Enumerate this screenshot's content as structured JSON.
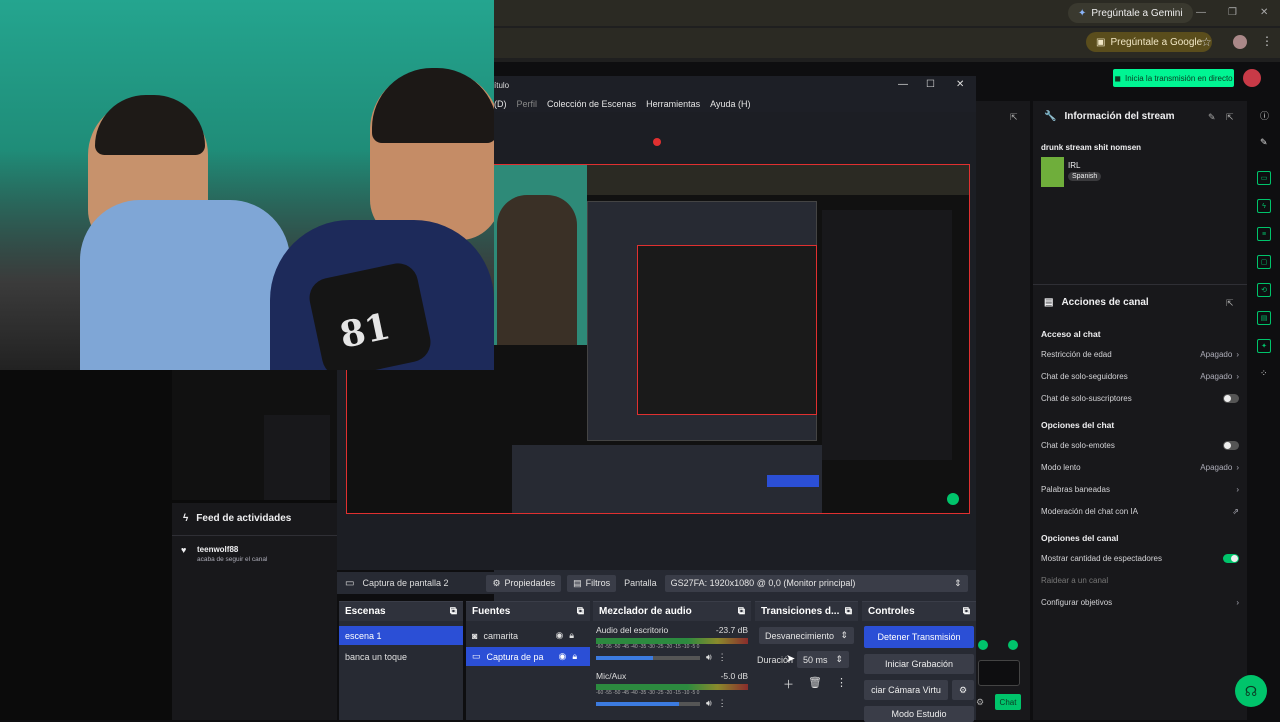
{
  "browser": {
    "gemini_label": "Pregúntale a Gemini",
    "google_label": "Pregúntale a Google",
    "win_min": "—",
    "win_max": "❐",
    "win_close": "✕"
  },
  "twitch": {
    "go_live_label": "Inicia la transmisión en directo",
    "stream_info_title": "Información del stream",
    "stream_title": "drunk stream shit nomsen",
    "category": "IRL",
    "language": "Spanish",
    "channel_actions_title": "Acciones de canal",
    "chat_access": "Acceso al chat",
    "rows": [
      {
        "label": "Restricción de edad",
        "value": "Apagado",
        "kind": "arrow"
      },
      {
        "label": "Chat de solo-seguidores",
        "value": "Apagado",
        "kind": "arrow"
      },
      {
        "label": "Chat de solo-suscriptores",
        "value": "",
        "kind": "toggle-off"
      }
    ],
    "chat_options": "Opciones del chat",
    "rows2": [
      {
        "label": "Chat de solo-emotes",
        "value": "",
        "kind": "toggle-off"
      },
      {
        "label": "Modo lento",
        "value": "Apagado",
        "kind": "arrow"
      },
      {
        "label": "Palabras baneadas",
        "value": "",
        "kind": "arrow"
      },
      {
        "label": "Moderación del chat con IA",
        "value": "",
        "kind": "external"
      }
    ],
    "channel_options": "Opciones del canal",
    "rows3": [
      {
        "label": "Mostrar cantidad de espectadores",
        "value": "",
        "kind": "toggle-on"
      },
      {
        "label": "Raidear a un canal",
        "value": "",
        "kind": "dim"
      },
      {
        "label": "Configurar objetivos",
        "value": "",
        "kind": "arrow"
      }
    ],
    "feed_title": "Feed de actividades",
    "feed_user": "teenwolf88",
    "feed_text": "acaba de seguir el canal",
    "chat_button": "Chat"
  },
  "obs": {
    "title_suffix": "ítulo",
    "menu": [
      "(D)",
      "Perfil",
      "Colección de Escenas",
      "Herramientas",
      "Ayuda (H)"
    ],
    "source_name": "Captura de pantalla 2",
    "properties": "Propiedades",
    "filters": "Filtros",
    "screen_label": "Pantalla",
    "screen_value": "GS27FA: 1920x1080 @ 0,0 (Monitor principal)",
    "scenes_title": "Escenas",
    "scenes": [
      "escena 1",
      "banca un toque"
    ],
    "sources_title": "Fuentes",
    "sources": [
      "camarita",
      "Captura de pa"
    ],
    "mixer_title": "Mezclador de audio",
    "mixer": [
      {
        "name": "Audio del escritorio",
        "db": "-23.7 dB",
        "slider": 0.55
      },
      {
        "name": "Mic/Aux",
        "db": "-5.0 dB",
        "slider": 0.8
      }
    ],
    "mixer_scale": "-60 -55 -50 -45 -40 -35 -30 -25 -20 -15 -10 -5 0",
    "transitions_title": "Transiciones d...",
    "transition": "Desvanecimiento",
    "duration_label": "Duración",
    "duration_value": "50 ms",
    "controls_title": "Controles",
    "controls": [
      "Detener Transmisión",
      "Iniciar Grabación",
      "ciar Cámara Virtu",
      "Modo Estudio"
    ]
  }
}
